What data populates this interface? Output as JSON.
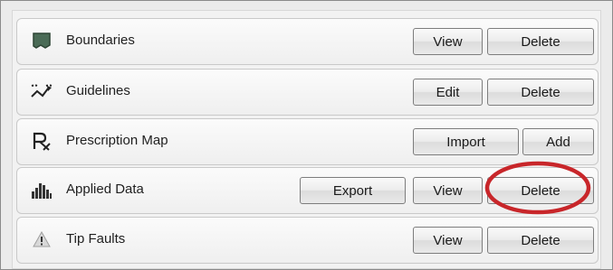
{
  "rows": [
    {
      "label": "Boundaries",
      "icon": "boundary-icon",
      "buttons": [
        "View",
        "Delete"
      ]
    },
    {
      "label": "Guidelines",
      "icon": "guidelines-icon",
      "buttons": [
        "Edit",
        "Delete"
      ]
    },
    {
      "label": "Prescription Map",
      "icon": "prescription-icon",
      "buttons": [
        "Import",
        "Add"
      ]
    },
    {
      "label": "Applied Data",
      "icon": "applied-data-icon",
      "buttons": [
        "Export",
        "View",
        "Delete"
      ]
    },
    {
      "label": "Tip Faults",
      "icon": "warning-icon",
      "buttons": [
        "View",
        "Delete"
      ]
    }
  ],
  "colors": {
    "highlight": "#c8262a",
    "boundary_icon": "#3b5b45",
    "text": "#1f1f1f"
  }
}
